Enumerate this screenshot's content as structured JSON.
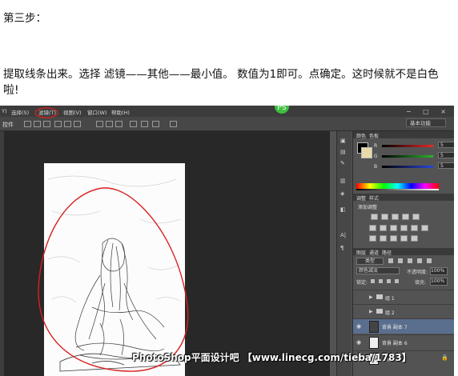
{
  "heading": "第三步：",
  "paragraph_line1": "提取线条出来。选择 滤镜——其他——最小值。 数值为1即可。点确定。这时候就不是白色",
  "paragraph_line2": "啦!",
  "screenshot": {
    "menu": {
      "items": [
        "Y)",
        "选择(S)",
        "滤镜(T)",
        "视图(V)",
        "窗口(W)",
        "帮助(H)"
      ],
      "highlighted": "滤镜(T)",
      "window_controls": "− □ ×"
    },
    "options_bar": {
      "label": "控件",
      "workspace": "基本功能"
    },
    "float_icon": "PS",
    "color_panel": {
      "tabs": [
        "颜色",
        "色板"
      ],
      "channels": [
        {
          "label": "R",
          "value": "5",
          "color": "#e82828"
        },
        {
          "label": "G",
          "value": "5",
          "color": "#2bb52b"
        },
        {
          "label": "B",
          "value": "5",
          "color": "#2a45d8"
        }
      ]
    },
    "adjustments_panel": {
      "tabs": [
        "调整",
        "样式"
      ],
      "title": "添加调整"
    },
    "layers_panel": {
      "tabs": [
        "图层",
        "通道",
        "路径"
      ],
      "filter_type": "类型",
      "blend_mode": "颜色减淡",
      "opacity_label": "不透明度:",
      "opacity_value": "100%",
      "lock_label": "锁定:",
      "fill_label": "填充:",
      "fill_value": "100%",
      "layers": [
        {
          "name": "组 1",
          "kind": "group",
          "visible": false,
          "selected": false
        },
        {
          "name": "组 2",
          "kind": "group",
          "visible": false,
          "selected": false
        },
        {
          "name": "背景 副本 7",
          "kind": "layer",
          "visible": true,
          "selected": true
        },
        {
          "name": "背景 副本 6",
          "kind": "layer",
          "visible": true,
          "selected": false
        },
        {
          "name": "背景",
          "kind": "layer",
          "visible": true,
          "selected": false
        }
      ]
    },
    "annotation_color": "#d92020",
    "watermark": "PhotoShop平面设计吧 【www.linecg.com/tieba/1783】"
  }
}
